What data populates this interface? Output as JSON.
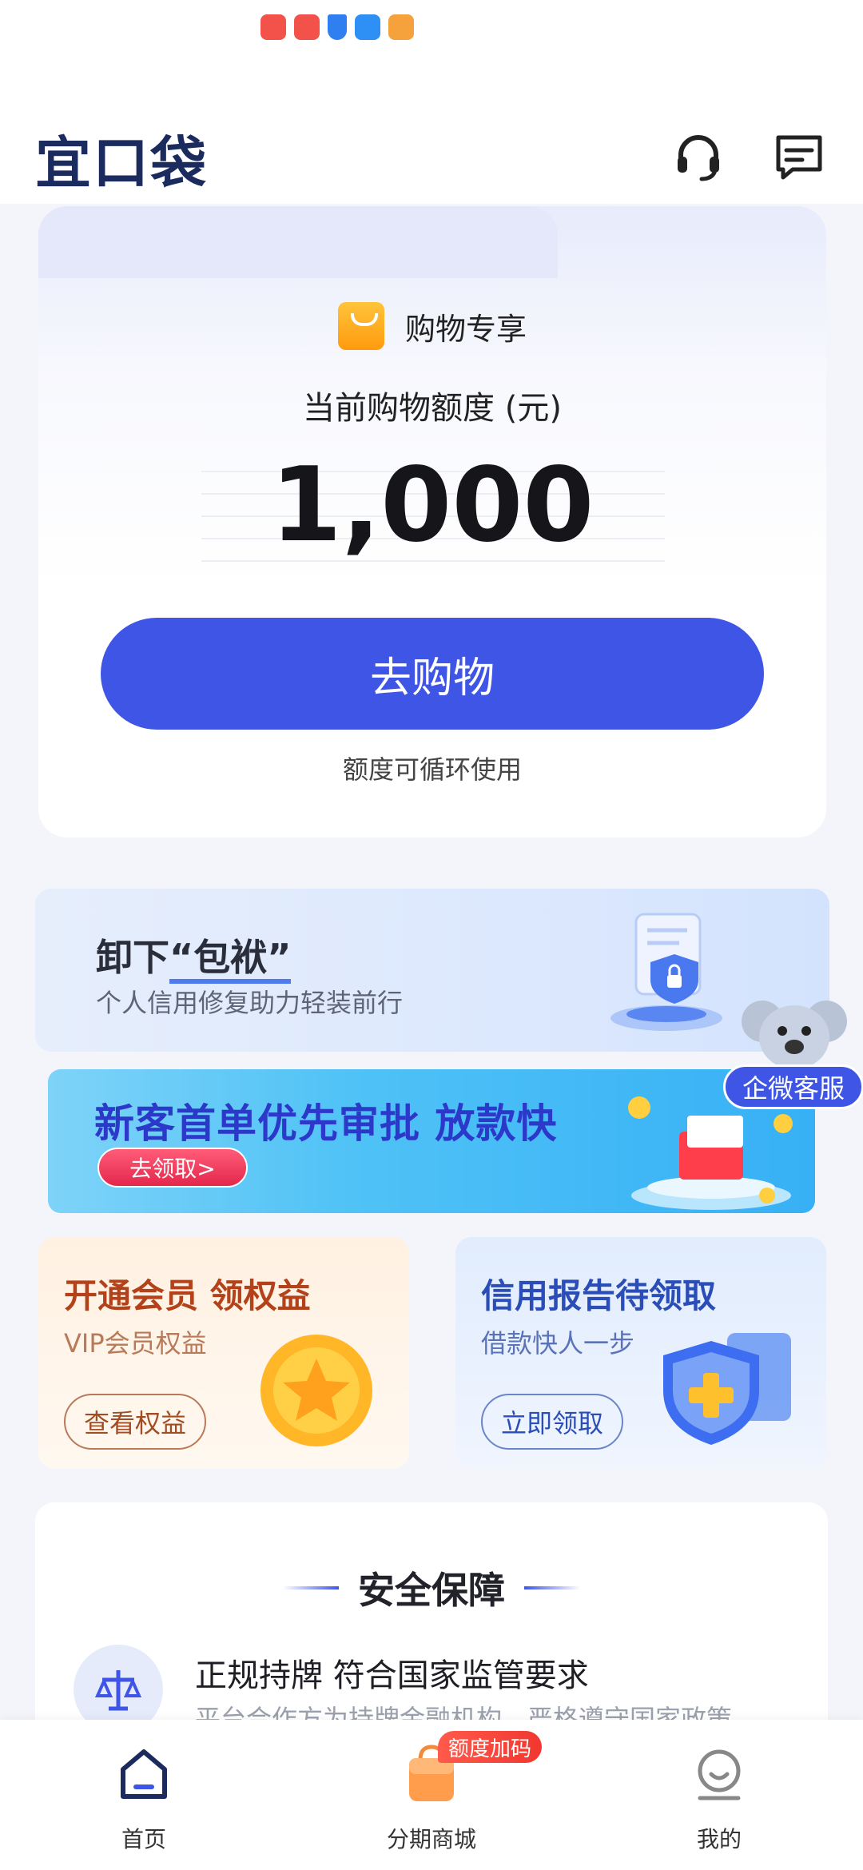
{
  "status_bar": {
    "icons": [
      "huawei-app-icon",
      "huawei-app-icon",
      "shield-app-icon",
      "weather-app-icon",
      "video-app-icon"
    ],
    "icon_colors": [
      "#f2524a",
      "#f2524a",
      "#2f7ff0",
      "#2e8ff5",
      "#f5a23c"
    ]
  },
  "header": {
    "logo_text": "宜口袋",
    "icons": [
      "headset-icon",
      "message-icon"
    ]
  },
  "limit_card": {
    "badge_label": "购物专享",
    "limit_label": "当前购物额度 (元)",
    "amount": "1,000",
    "cta_label": "去购物",
    "note": "额度可循环使用"
  },
  "banner_credit_repair": {
    "title_prefix": "卸下",
    "title_highlight": "“包袱”",
    "subtitle": "个人信用修复助力轻装前行"
  },
  "floating_service": {
    "label": "企微客服"
  },
  "banner_new_customer": {
    "title": "新客首单优先审批 放款快",
    "button_label": "去领取>"
  },
  "promo_cards": [
    {
      "title": "开通会员 领权益",
      "subtitle": "VIP会员权益",
      "button_label": "查看权益"
    },
    {
      "title": "信用报告待领取",
      "subtitle": "借款快人一步",
      "button_label": "立即领取"
    }
  ],
  "security": {
    "title": "安全保障",
    "item_title": "正规持牌 符合国家监管要求",
    "item_desc": "平台合作方为持牌金融机构，严格遵守国家政策"
  },
  "tabbar": {
    "tabs": [
      {
        "label": "首页",
        "active": true
      },
      {
        "label": "分期商城",
        "active": false
      },
      {
        "label": "我的",
        "active": false
      }
    ],
    "badge": "额度加码"
  },
  "colors": {
    "accent": "#3e55e6",
    "logo": "#1c2b5e"
  }
}
